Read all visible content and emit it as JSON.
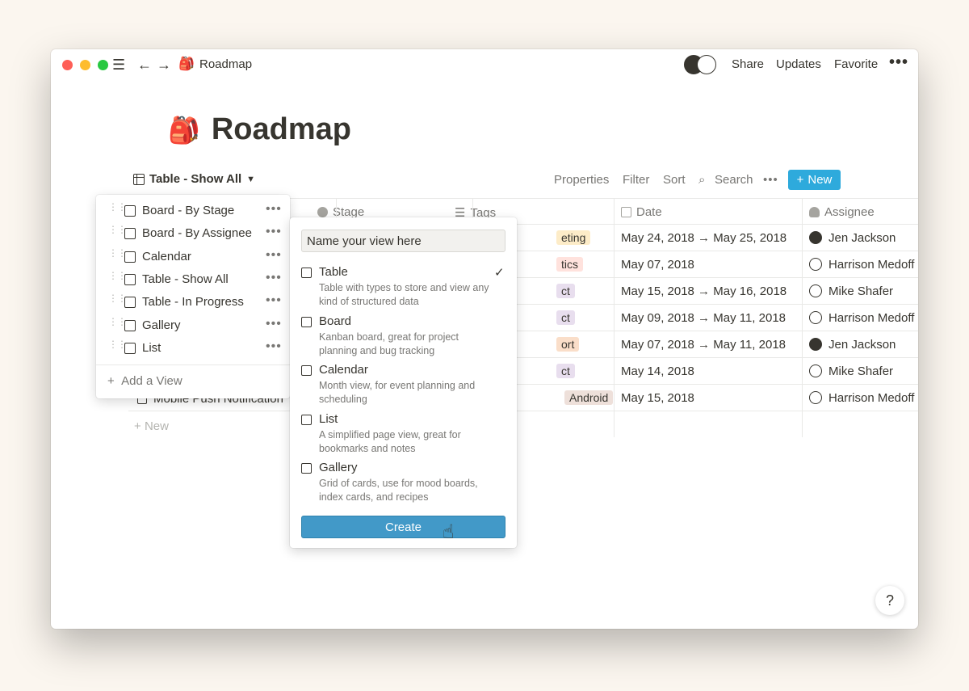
{
  "window": {
    "title": "Roadmap",
    "actions": {
      "share": "Share",
      "updates": "Updates",
      "favorite": "Favorite",
      "more": "•••"
    }
  },
  "page": {
    "emoji": "🎒",
    "title": "Roadmap"
  },
  "view_switcher": {
    "label": "Table - Show All"
  },
  "toolbar": {
    "properties": "Properties",
    "filter": "Filter",
    "sort": "Sort",
    "search": "Search",
    "more": "•••",
    "new": "New"
  },
  "columns": {
    "stage": "Stage",
    "tags": "Tags",
    "date": "Date",
    "assignee": "Assignee"
  },
  "rows": [
    {
      "tag": "eting",
      "tag_color": "#fdecc8",
      "date": "May 24, 2018 → May 25, 2018",
      "assignee": "Jen Jackson"
    },
    {
      "tag": "tics",
      "tag_color": "#ffe2dd",
      "date": "May 07, 2018",
      "assignee": "Harrison Medoff"
    },
    {
      "tag": "ct",
      "tag_color": "#e8deee",
      "date": "May 15, 2018 → May 16, 2018",
      "assignee": "Mike Shafer"
    },
    {
      "tag": "ct",
      "tag_color": "#e8deee",
      "date": "May 09, 2018 → May 11, 2018",
      "assignee": "Harrison Medoff"
    },
    {
      "tag": "ort",
      "tag_color": "#fadec9",
      "date": "May 07, 2018 → May 11, 2018",
      "assignee": "Jen Jackson"
    },
    {
      "tag": "ct",
      "tag_color": "#e8deee",
      "date": "May 14, 2018",
      "assignee": "Mike Shafer"
    },
    {
      "tag": "Android",
      "tag_color": "#eee0da",
      "date": "May 15, 2018",
      "assignee": "Harrison Medoff"
    }
  ],
  "partial_row_name": "Mobile Push Notification",
  "new_row": "New",
  "views_menu": {
    "items": [
      {
        "label": "Board - By Stage",
        "icon": "board-icon"
      },
      {
        "label": "Board - By Assignee",
        "icon": "board-icon"
      },
      {
        "label": "Calendar",
        "icon": "calendar-icon"
      },
      {
        "label": "Table - Show All",
        "icon": "table-icon"
      },
      {
        "label": "Table - In Progress",
        "icon": "table-icon"
      },
      {
        "label": "Gallery",
        "icon": "gallery-icon"
      },
      {
        "label": "List",
        "icon": "list-icon"
      }
    ],
    "more": "•••",
    "add": "Add a View"
  },
  "create_menu": {
    "input_value": "Name your view here",
    "options": [
      {
        "title": "Table",
        "desc": "Table with types to store and view any kind of structured data",
        "selected": true
      },
      {
        "title": "Board",
        "desc": "Kanban board, great for project planning and bug tracking"
      },
      {
        "title": "Calendar",
        "desc": "Month view, for event planning and scheduling"
      },
      {
        "title": "List",
        "desc": "A simplified page view, great for bookmarks and notes"
      },
      {
        "title": "Gallery",
        "desc": "Grid of cards, use for mood boards, index cards, and recipes"
      }
    ],
    "create": "Create"
  },
  "help": "?",
  "colors": {
    "accent": "#2eaadc",
    "create_button": "#4299c8"
  }
}
